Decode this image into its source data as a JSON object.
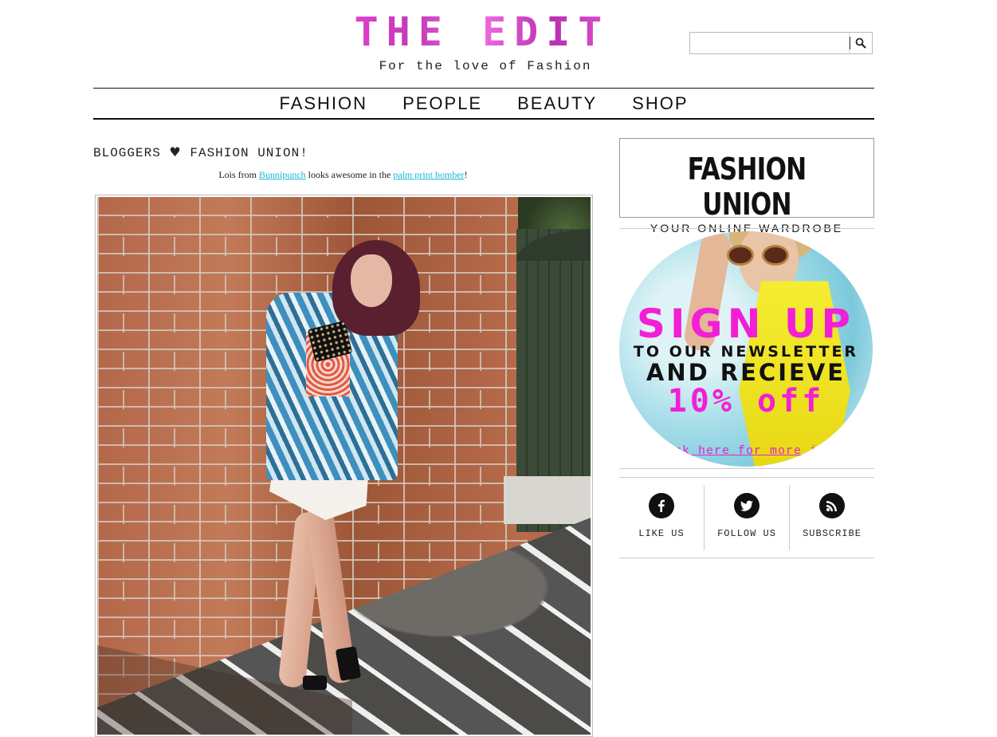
{
  "header": {
    "logo": "THE EDIT",
    "tagline": "For the love of Fashion",
    "search": {
      "placeholder": "",
      "value": "",
      "button_icon": "search-icon"
    }
  },
  "nav": {
    "items": [
      "FASHION",
      "PEOPLE",
      "BEAUTY",
      "SHOP"
    ]
  },
  "post": {
    "title_pre": "BLOGGERS",
    "title_heart": "♥",
    "title_post": "FASHION UNION!",
    "caption": {
      "prefix": "Lois from ",
      "link1": "Bunnipunch",
      "middle": " looks awesome in the ",
      "link2": "palm print bomber",
      "suffix": "!"
    }
  },
  "sidebar": {
    "brand": {
      "name": "FASHION UNION",
      "subtitle": "YOUR ONLINE WARDROBE"
    },
    "promo": {
      "line1": "SIGN UP",
      "line2": "TO OUR NEWSLETTER",
      "line3": "AND RECIEVE",
      "line4": "10% off",
      "cta": "Click here for more info"
    },
    "social": [
      {
        "label": "LIKE US",
        "icon": "facebook-icon"
      },
      {
        "label": "FOLLOW US",
        "icon": "twitter-icon"
      },
      {
        "label": "SUBSCRIBE",
        "icon": "rss-icon"
      }
    ]
  },
  "colors": {
    "logo_pink": "#e83fd2",
    "link_cyan": "#14b6d6",
    "promo_magenta": "#f21fd6"
  }
}
